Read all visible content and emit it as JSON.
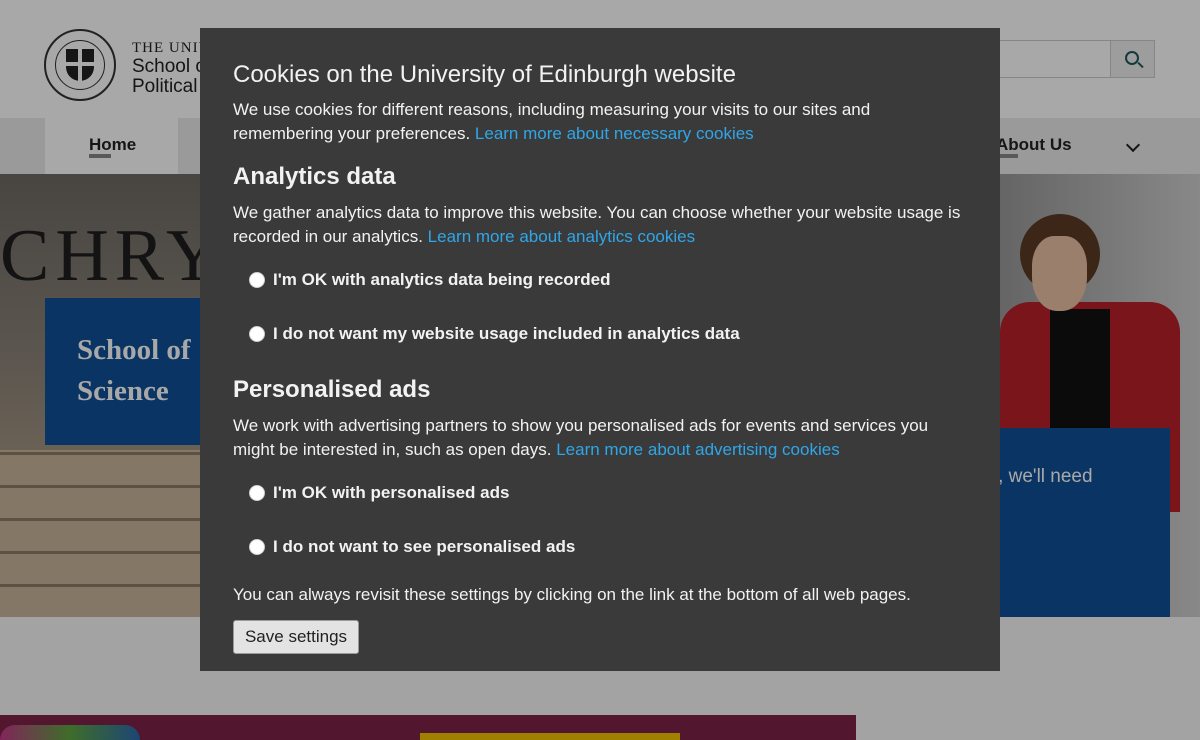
{
  "site": {
    "crest_line1": "THE UNIVERSITY",
    "crest_line2": "School of Social and",
    "crest_line3": "Political Science",
    "nav": {
      "home_label": "Home",
      "about_label": "About Us"
    },
    "hero": {
      "sign_text": "CHRYS",
      "card_line1": "School of",
      "card_line2": "Science",
      "right_card_text": "y, we'll need"
    }
  },
  "cookie_modal": {
    "title": "Cookies on the University of Edinburgh website",
    "intro_text": "We use cookies for different reasons, including measuring your visits to our sites and remembering your preferences.",
    "intro_link": "Learn more about necessary cookies",
    "analytics": {
      "heading": "Analytics data",
      "text": "We gather analytics data to improve this website. You can choose whether your website usage is recorded in our analytics.",
      "link": "Learn more about analytics cookies",
      "option_yes": "I'm OK with analytics data being recorded",
      "option_no": "I do not want my website usage included in analytics data"
    },
    "ads": {
      "heading": "Personalised ads",
      "text": "We work with advertising partners to show you personalised ads for events and services you might be interested in, such as open days.",
      "link": "Learn more about advertising cookies",
      "option_yes": "I'm OK with personalised ads",
      "option_no": "I do not want to see personalised ads"
    },
    "footer_text": "You can always revisit these settings by clicking on the link at the bottom of all web pages.",
    "save_label": "Save settings"
  }
}
